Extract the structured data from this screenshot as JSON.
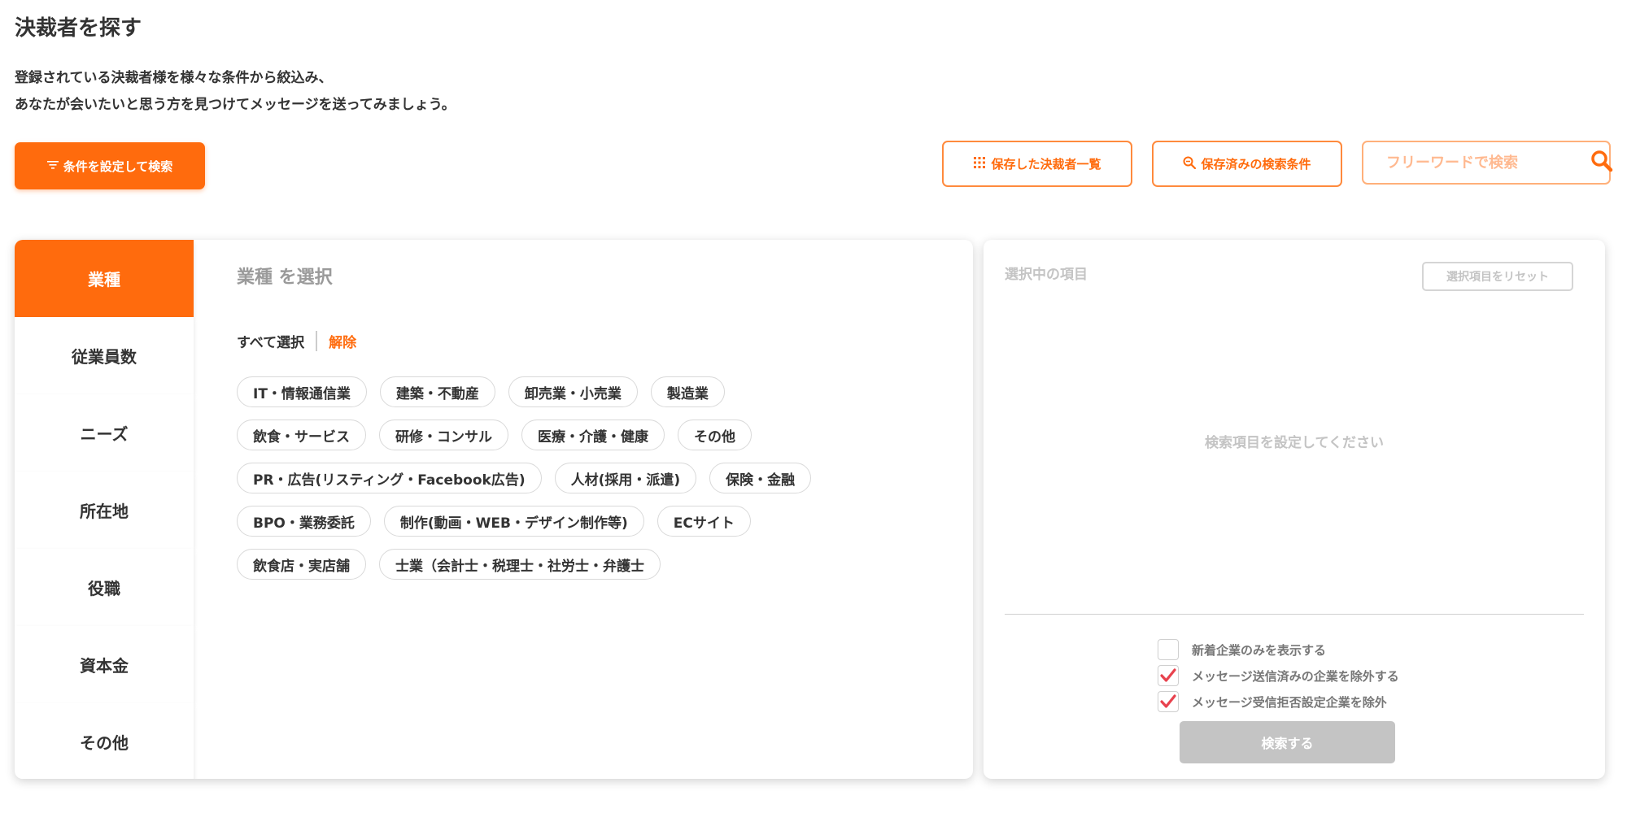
{
  "header": {
    "title": "決裁者を探す",
    "description_line1": "登録されている決裁者様を様々な条件から絞込み、",
    "description_line2": "あなたが会いたいと思う方を見つけてメッセージを送ってみましょう。"
  },
  "toolbar": {
    "filter_button": "条件を設定して検索",
    "saved_list_button": "保存した決裁者一覧",
    "saved_conditions_button": "保存済みの検索条件",
    "freeword_placeholder": "フリーワードで検索"
  },
  "tabs": [
    "業種",
    "従業員数",
    "ニーズ",
    "所在地",
    "役職",
    "資本金",
    "その他"
  ],
  "panel": {
    "title": "業種 を選択",
    "select_all": "すべて選択",
    "unselect": "解除",
    "chip_rows": [
      [
        "IT・情報通信業",
        "建築・不動産",
        "卸売業・小売業",
        "製造業"
      ],
      [
        "飲食・サービス",
        "研修・コンサル",
        "医療・介護・健康",
        "その他"
      ],
      [
        "PR・広告(リスティング・Facebook広告)",
        "人材(採用・派遣)",
        "保険・金融"
      ],
      [
        "BPO・業務委託",
        "制作(動画・WEB・デザイン制作等)",
        "ECサイト"
      ],
      [
        "飲食店・実店舗",
        "士業（会計士・税理士・社労士・弁護士"
      ]
    ]
  },
  "selection": {
    "title": "選択中の項目",
    "reset_button": "選択項目をリセット",
    "empty_message": "検索項目を設定してください",
    "options": [
      {
        "label": "新着企業のみを表示する",
        "checked": false
      },
      {
        "label": "メッセージ送信済みの企業を除外する",
        "checked": true
      },
      {
        "label": "メッセージ受信拒否設定企業を除外",
        "checked": true
      }
    ],
    "submit_button": "検索する"
  },
  "colors": {
    "accent": "#ff6b0d",
    "check": "#e8424e",
    "disabled": "#c4c4c4"
  }
}
